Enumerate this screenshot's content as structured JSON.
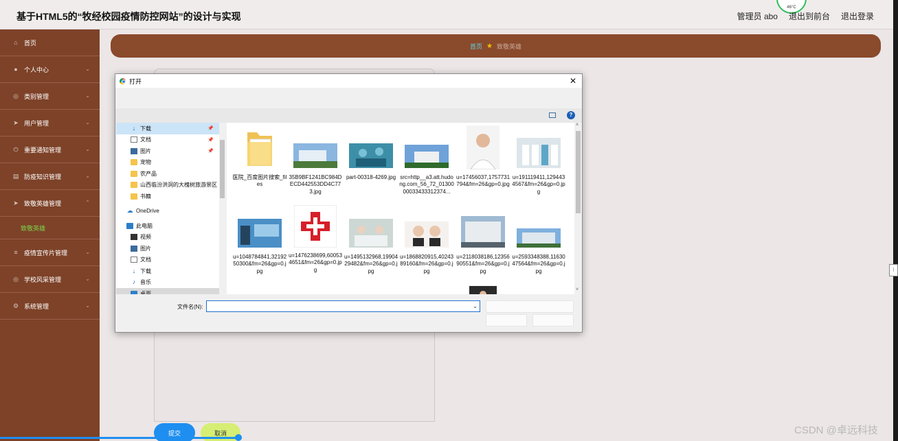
{
  "header": {
    "title": "基于HTML5的“牧经校园疫情防控网站”的设计与实现",
    "admin": "管理员 abo",
    "back_front": "退出到前台",
    "logout": "退出登录",
    "temp": "46°C"
  },
  "sidebar": {
    "items": [
      {
        "label": "首页",
        "icon": "home-icon"
      },
      {
        "label": "个人中心",
        "icon": "user-icon"
      },
      {
        "label": "类别管理",
        "icon": "compass-icon"
      },
      {
        "label": "用户管理",
        "icon": "send-icon"
      },
      {
        "label": "重要通知管理",
        "icon": "power-icon"
      },
      {
        "label": "防疫知识管理",
        "icon": "book-icon"
      },
      {
        "label": "致敬英雄管理",
        "icon": "send-icon"
      }
    ],
    "sub_item": "致敬英雄",
    "items_after": [
      {
        "label": "疫情宣传片管理",
        "icon": "sliders-icon"
      },
      {
        "label": "学校风采管理",
        "icon": "compass-icon"
      },
      {
        "label": "系统管理",
        "icon": "gear-icon"
      }
    ]
  },
  "breadcrumb": {
    "home": "首页",
    "current": "致敬英雄"
  },
  "form": {
    "submit": "提交",
    "cancel": "取消"
  },
  "watermark": "CSDN @卓远科技",
  "dialog": {
    "title": "打开",
    "tree": [
      {
        "label": "下载",
        "icon": "download-icon",
        "pin": true
      },
      {
        "label": "文档",
        "icon": "document-icon",
        "pin": true
      },
      {
        "label": "图片",
        "icon": "picture-icon",
        "pin": true
      },
      {
        "label": "宠物",
        "icon": "folder-icon"
      },
      {
        "label": "农产品",
        "icon": "folder-icon"
      },
      {
        "label": "山西临汾洪洞的大槐树旅游景区",
        "icon": "folder-icon"
      },
      {
        "label": "书籍",
        "icon": "folder-icon"
      },
      {
        "label": "OneDrive",
        "icon": "onedrive-icon"
      },
      {
        "label": "此电脑",
        "icon": "computer-icon"
      },
      {
        "label": "视频",
        "icon": "video-icon"
      },
      {
        "label": "图片",
        "icon": "picture-icon"
      },
      {
        "label": "文档",
        "icon": "document-icon"
      },
      {
        "label": "下载",
        "icon": "download-icon"
      },
      {
        "label": "音乐",
        "icon": "music-icon"
      },
      {
        "label": "桌面",
        "icon": "desktop-icon"
      }
    ],
    "files": [
      "医院_百度图片搜索_files",
      "35B9BF1241BC984DECD442553DD4C773.jpg",
      "part-00318-4269.jpg",
      "src=http__a3.att.hudong.com_56_72_0130000033433312374...",
      "u=17456037,1757731794&fm=26&gp=0.jpg",
      "u=191119411,1294434567&fm=26&gp=0.jpg",
      "u=1048784841,3219250300&fm=26&gp=0.jpg",
      "u=1476238699,600534651&fm=26&gp=0.jpg",
      "u=1495132968,1990429482&fm=26&gp=0.jpg",
      "u=1868820915,4024389160&fm=26&gp=0.jpg",
      "u=2118038186,1235690551&fm=26&gp=0.jpg",
      "u=2593348388,1163047564&fm=26&gp=0.jpg"
    ],
    "filename_label": "文件名(N):",
    "filename_value": ""
  }
}
